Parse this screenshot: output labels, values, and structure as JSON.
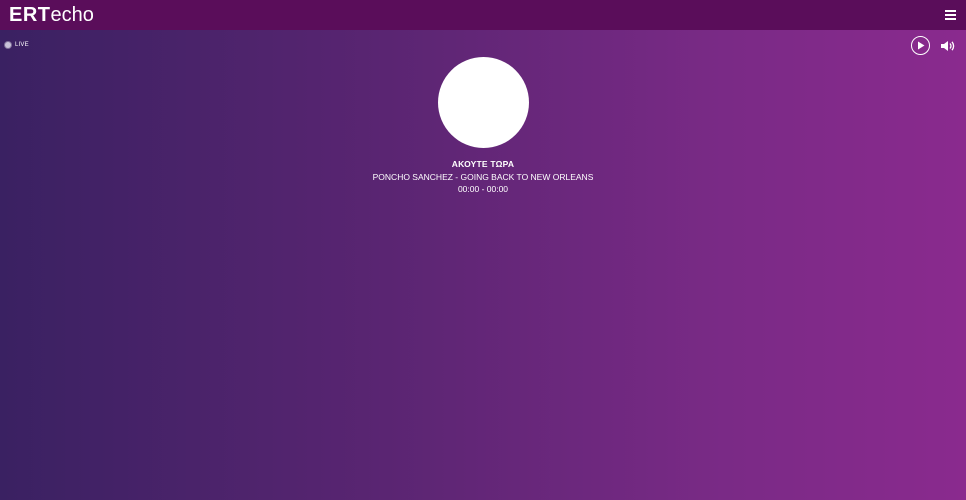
{
  "header": {
    "logo_ert": "ERT",
    "logo_echo": "echo",
    "menu_icon": "hamburger-icon"
  },
  "status": {
    "live_label": "LIVE"
  },
  "player": {
    "play_icon": "play-icon",
    "volume_icon": "speaker-icon",
    "now_playing_label": "ΑΚΟΥΤΕ ΤΩΡΑ",
    "track": "PONCHO SANCHEZ - GOING BACK TO NEW ORLEANS",
    "time": "00:00 - 00:00"
  },
  "colors": {
    "topbar": "#5a0d5a",
    "gradient_start": "#3a2162",
    "gradient_end": "#8a2a8e",
    "text": "#ffffff"
  }
}
